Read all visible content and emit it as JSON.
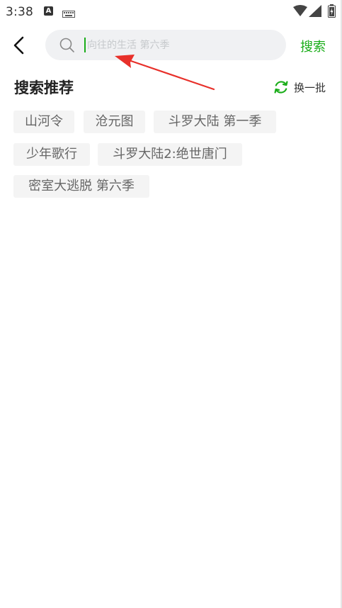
{
  "status_bar": {
    "time": "3:38",
    "a_icon_letter": "A",
    "icons": [
      "a-icon",
      "keyboard-icon",
      "wifi-icon",
      "signal-icon",
      "battery-icon"
    ]
  },
  "header": {
    "back_icon": "chevron-left-icon",
    "search": {
      "placeholder": "向往的生活 第六季",
      "value": ""
    },
    "search_button_label": "搜索"
  },
  "recommend": {
    "title": "搜索推荐",
    "refresh_label": "换一批",
    "tags": [
      "山河令",
      "沧元图",
      "斗罗大陆 第一季",
      "少年歌行",
      "斗罗大陆2:绝世唐门",
      "密室大逃脱 第六季"
    ]
  },
  "colors": {
    "accent": "#1aad19",
    "search_bg": "#f0f1f3",
    "tag_bg": "#f4f4f4",
    "tag_text": "#666666",
    "annotation_arrow": "#e8302a"
  }
}
